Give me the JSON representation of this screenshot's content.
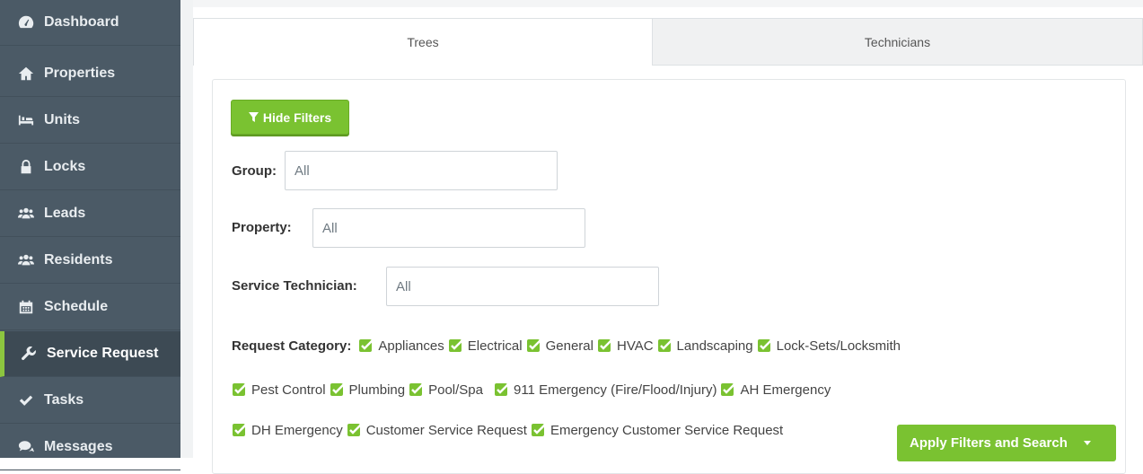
{
  "sidebar": {
    "items": [
      {
        "label": "Dashboard",
        "icon": "tachometer-icon"
      },
      {
        "label": "Properties",
        "icon": "home-icon"
      },
      {
        "label": "Units",
        "icon": "bed-icon"
      },
      {
        "label": "Locks",
        "icon": "lock-icon"
      },
      {
        "label": "Leads",
        "icon": "users-icon"
      },
      {
        "label": "Residents",
        "icon": "users-icon"
      },
      {
        "label": "Schedule",
        "icon": "calendar-icon"
      },
      {
        "label": "Service Request",
        "icon": "wrench-icon",
        "active": true
      },
      {
        "label": "Tasks",
        "icon": "check-icon"
      },
      {
        "label": "Messages",
        "icon": "comments-icon"
      }
    ]
  },
  "tabs": [
    {
      "label": "Trees",
      "active": true
    },
    {
      "label": "Technicians",
      "active": false
    }
  ],
  "filters": {
    "hide_label": "Hide Filters",
    "group": {
      "label": "Group:",
      "placeholder": "All"
    },
    "property": {
      "label": "Property:",
      "placeholder": "All"
    },
    "technician": {
      "label": "Service Technician:",
      "placeholder": "All"
    },
    "category_label": "Request Category:",
    "categories": [
      "Appliances",
      "Electrical",
      "General",
      "HVAC",
      "Landscaping",
      "Lock-Sets/Locksmith",
      "Pest Control",
      "Plumbing",
      "Pool/Spa",
      "911 Emergency (Fire/Flood/Injury)",
      "AH Emergency",
      "DH Emergency",
      "Customer Service Request",
      "Emergency Customer Service Request"
    ],
    "apply_label": "Apply Filters and Search"
  },
  "colors": {
    "sidebar_bg": "#4b5a66",
    "accent_green": "#7ac231",
    "active_indicator": "#8cc63f"
  }
}
